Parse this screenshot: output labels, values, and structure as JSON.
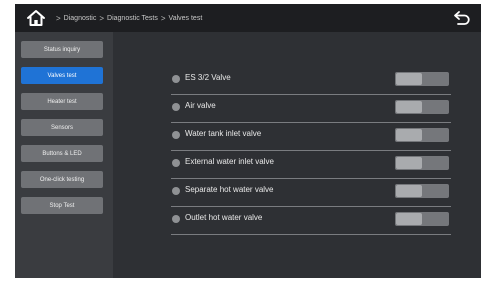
{
  "header": {
    "breadcrumbs": [
      "Diagnostic",
      "Diagnostic Tests",
      "Valves test"
    ],
    "separator": ">"
  },
  "sidebar": {
    "items": [
      {
        "label": "Status inquiry",
        "active": false
      },
      {
        "label": "Valves test",
        "active": true
      },
      {
        "label": "Heater test",
        "active": false
      },
      {
        "label": "Sensors",
        "active": false
      },
      {
        "label": "Buttons & LED",
        "active": false
      },
      {
        "label": "One-click testing",
        "active": false
      },
      {
        "label": "Stop Test",
        "active": false
      }
    ]
  },
  "valves": [
    {
      "label": "ES 3/2 Valve",
      "on": false
    },
    {
      "label": "Air valve",
      "on": false
    },
    {
      "label": "Water tank inlet valve",
      "on": false
    },
    {
      "label": "External water inlet valve",
      "on": false
    },
    {
      "label": "Separate hot water valve",
      "on": false
    },
    {
      "label": "Outlet hot water valve",
      "on": false
    }
  ],
  "colors": {
    "accent": "#1f73d6",
    "screen_bg": "#2e3034",
    "topbar_bg": "#1d1e21",
    "sidebar_bg": "#3a3c40"
  },
  "icons": {
    "home": "home-icon",
    "back": "back-arrow-icon",
    "status": "status-dot-icon"
  }
}
